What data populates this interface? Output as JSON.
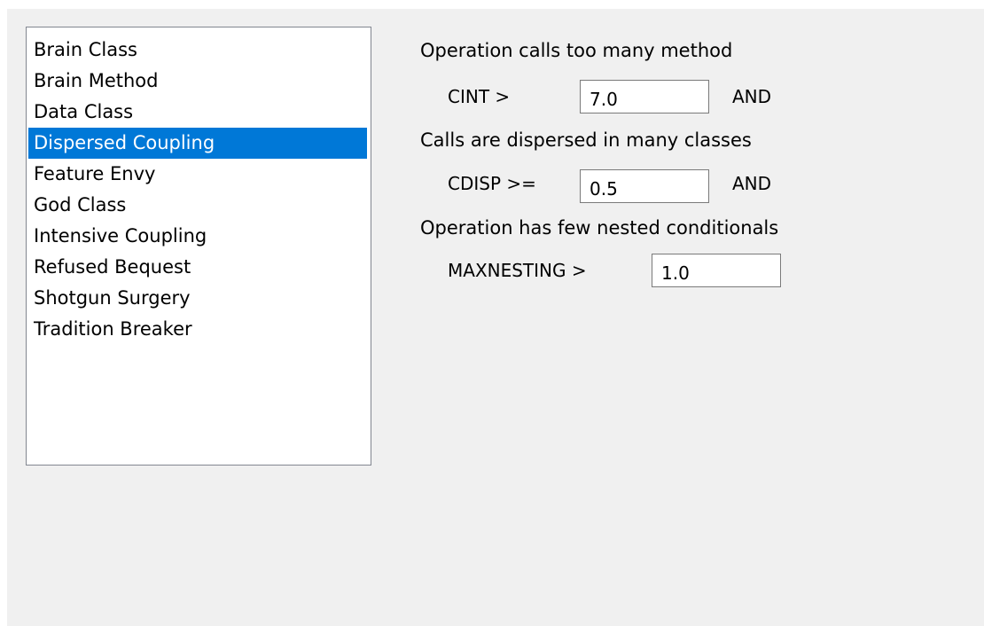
{
  "smell_list": {
    "items": [
      {
        "label": "Brain Class",
        "selected": false
      },
      {
        "label": "Brain Method",
        "selected": false
      },
      {
        "label": "Data Class",
        "selected": false
      },
      {
        "label": "Dispersed Coupling",
        "selected": true
      },
      {
        "label": "Feature Envy",
        "selected": false
      },
      {
        "label": "God Class",
        "selected": false
      },
      {
        "label": "Intensive Coupling",
        "selected": false
      },
      {
        "label": "Refused Bequest",
        "selected": false
      },
      {
        "label": "Shotgun Surgery",
        "selected": false
      },
      {
        "label": "Tradition Breaker",
        "selected": false
      }
    ],
    "selected_color": "#0078d7"
  },
  "criteria": {
    "conditions": [
      {
        "description": "Operation calls too many method",
        "metric_label": "CINT >",
        "value": "7.0",
        "connector": "AND"
      },
      {
        "description": "Calls are dispersed in many classes",
        "metric_label": "CDISP >=",
        "value": "0.5",
        "connector": "AND"
      },
      {
        "description": "Operation has few nested conditionals",
        "metric_label": "MAXNESTING >",
        "value": "1.0",
        "connector": ""
      }
    ]
  }
}
